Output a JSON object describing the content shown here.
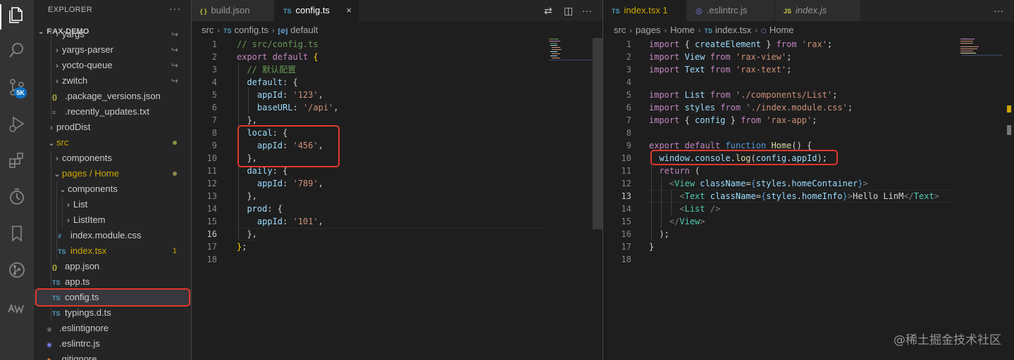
{
  "explorer": {
    "title": "EXPLORER",
    "more": "···",
    "project": "RAX-DEMO",
    "items": [
      {
        "label": "yargs",
        "icon": "folder",
        "depth": 1,
        "status": ""
      },
      {
        "label": "yargs-parser",
        "icon": "folder",
        "depth": 1,
        "status": ""
      },
      {
        "label": "yocto-queue",
        "icon": "folder",
        "depth": 1,
        "status": ""
      },
      {
        "label": "zwitch",
        "icon": "folder",
        "depth": 1,
        "status": ""
      },
      {
        "label": ".package_versions.json",
        "icon": "json",
        "depth": 1,
        "status": ""
      },
      {
        "label": ".recently_updates.txt",
        "icon": "txt",
        "depth": 1,
        "status": ""
      },
      {
        "label": "prodDist",
        "icon": "folder",
        "depth": 0,
        "status": ""
      },
      {
        "label": "src",
        "icon": "folder-open",
        "depth": 0,
        "status": "dot"
      },
      {
        "label": "components",
        "icon": "folder",
        "depth": 1,
        "status": ""
      },
      {
        "label": "pages / Home",
        "icon": "folder-open",
        "depth": 1,
        "status": "dot"
      },
      {
        "label": "components",
        "icon": "folder-open",
        "depth": 2,
        "status": ""
      },
      {
        "label": "List",
        "icon": "folder",
        "depth": 3,
        "status": ""
      },
      {
        "label": "ListItem",
        "icon": "folder",
        "depth": 3,
        "status": ""
      },
      {
        "label": "index.module.css",
        "icon": "css",
        "depth": 2,
        "status": ""
      },
      {
        "label": "index.tsx",
        "icon": "ts",
        "depth": 2,
        "status": "1"
      },
      {
        "label": "app.json",
        "icon": "json",
        "depth": 1,
        "status": ""
      },
      {
        "label": "app.ts",
        "icon": "ts",
        "depth": 1,
        "status": ""
      },
      {
        "label": "config.ts",
        "icon": "ts",
        "depth": 1,
        "status": ""
      },
      {
        "label": "typings.d.ts",
        "icon": "ts",
        "depth": 1,
        "status": ""
      },
      {
        "label": ".eslintignore",
        "icon": "eslintignore",
        "depth": 0,
        "status": ""
      },
      {
        "label": ".eslintrc.js",
        "icon": "eslint",
        "depth": 0,
        "status": ""
      },
      {
        "label": ".gitignore",
        "icon": "git",
        "depth": 0,
        "status": ""
      }
    ]
  },
  "activity_bar": {
    "scm_badge": "5K",
    "icons": [
      "files-icon",
      "search-icon",
      "source-control-icon",
      "run-debug-icon",
      "extensions-icon",
      "timeline-icon",
      "bookmark-icon",
      "git-graph-icon",
      "aw-icon"
    ]
  },
  "left_editor": {
    "tabs": [
      {
        "icon": "{ }",
        "label": "build.json",
        "active": false
      },
      {
        "icon": "TS",
        "label": "config.ts",
        "active": true,
        "close": "×"
      }
    ],
    "breadcrumbs": [
      "src",
      "config.ts",
      "default"
    ],
    "breadcrumb_icons": [
      "TS",
      "[⊘]"
    ],
    "lines": [
      [
        [
          "cm",
          "// src/config.ts"
        ]
      ],
      [
        [
          "kw",
          "export"
        ],
        [
          "pl",
          " "
        ],
        [
          "kw",
          "default"
        ],
        [
          "pl",
          " "
        ],
        [
          "br",
          "{"
        ]
      ],
      [
        [
          "pl",
          "  "
        ],
        [
          "cm",
          "// 默认配置"
        ]
      ],
      [
        [
          "pl",
          "  "
        ],
        [
          "pr",
          "default"
        ],
        [
          "pl",
          ": {"
        ]
      ],
      [
        [
          "pl",
          "    "
        ],
        [
          "pr",
          "appId"
        ],
        [
          "pl",
          ": "
        ],
        [
          "st",
          "'123'"
        ],
        [
          "pl",
          ","
        ]
      ],
      [
        [
          "pl",
          "    "
        ],
        [
          "pr",
          "baseURL"
        ],
        [
          "pl",
          ": "
        ],
        [
          "st",
          "'/api'"
        ],
        [
          "pl",
          ","
        ]
      ],
      [
        [
          "pl",
          "  },"
        ]
      ],
      [
        [
          "pl",
          "  "
        ],
        [
          "pr",
          "local"
        ],
        [
          "pl",
          ": {"
        ]
      ],
      [
        [
          "pl",
          "    "
        ],
        [
          "pr",
          "appId"
        ],
        [
          "pl",
          ": "
        ],
        [
          "st",
          "'456'"
        ],
        [
          "pl",
          ","
        ]
      ],
      [
        [
          "pl",
          "  },"
        ]
      ],
      [
        [
          "pl",
          "  "
        ],
        [
          "pr",
          "daily"
        ],
        [
          "pl",
          ": {"
        ]
      ],
      [
        [
          "pl",
          "    "
        ],
        [
          "pr",
          "appId"
        ],
        [
          "pl",
          ": "
        ],
        [
          "st",
          "'789'"
        ],
        [
          "pl",
          ","
        ]
      ],
      [
        [
          "pl",
          "  },"
        ]
      ],
      [
        [
          "pl",
          "  "
        ],
        [
          "pr",
          "prod"
        ],
        [
          "pl",
          ": {"
        ]
      ],
      [
        [
          "pl",
          "    "
        ],
        [
          "pr",
          "appId"
        ],
        [
          "pl",
          ": "
        ],
        [
          "st",
          "'101'"
        ],
        [
          "pl",
          ","
        ]
      ],
      [
        [
          "pl",
          "  },"
        ]
      ],
      [
        [
          "br",
          "}"
        ],
        [
          "pl",
          ";"
        ]
      ],
      []
    ],
    "current_line": 16
  },
  "right_editor": {
    "tabs": [
      {
        "icon": "TS",
        "label": "index.tsx 1",
        "active": true
      },
      {
        "icon": "◎",
        "label": ".eslintrc.js",
        "active": false
      },
      {
        "icon": "JS",
        "label": "index.js",
        "active": false
      }
    ],
    "breadcrumbs": [
      "src",
      "pages",
      "Home",
      "index.tsx",
      "Home"
    ],
    "lines": [
      [
        [
          "kw",
          "import"
        ],
        [
          "pl",
          " { "
        ],
        [
          "va",
          "createElement"
        ],
        [
          "pl",
          " } "
        ],
        [
          "kw",
          "from"
        ],
        [
          "pl",
          " "
        ],
        [
          "st",
          "'rax'"
        ],
        [
          "pl",
          ";"
        ]
      ],
      [
        [
          "kw",
          "import"
        ],
        [
          "pl",
          " "
        ],
        [
          "va",
          "View"
        ],
        [
          "pl",
          " "
        ],
        [
          "kw",
          "from"
        ],
        [
          "pl",
          " "
        ],
        [
          "st",
          "'rax-view'"
        ],
        [
          "pl",
          ";"
        ]
      ],
      [
        [
          "kw",
          "import"
        ],
        [
          "pl",
          " "
        ],
        [
          "va",
          "Text"
        ],
        [
          "pl",
          " "
        ],
        [
          "kw",
          "from"
        ],
        [
          "pl",
          " "
        ],
        [
          "st",
          "'rax-text'"
        ],
        [
          "pl",
          ";"
        ]
      ],
      [],
      [
        [
          "kw",
          "import"
        ],
        [
          "pl",
          " "
        ],
        [
          "va",
          "List"
        ],
        [
          "pl",
          " "
        ],
        [
          "kw",
          "from"
        ],
        [
          "pl",
          " "
        ],
        [
          "st",
          "'./components/List'"
        ],
        [
          "pl",
          ";"
        ]
      ],
      [
        [
          "kw",
          "import"
        ],
        [
          "pl",
          " "
        ],
        [
          "va",
          "styles"
        ],
        [
          "pl",
          " "
        ],
        [
          "kw",
          "from"
        ],
        [
          "pl",
          " "
        ],
        [
          "st",
          "'./index.module.css'"
        ],
        [
          "pl",
          ";"
        ]
      ],
      [
        [
          "kw",
          "import"
        ],
        [
          "pl",
          " { "
        ],
        [
          "va",
          "config"
        ],
        [
          "pl",
          " } "
        ],
        [
          "kw",
          "from"
        ],
        [
          "pl",
          " "
        ],
        [
          "st",
          "'rax-app'"
        ],
        [
          "pl",
          ";"
        ]
      ],
      [],
      [
        [
          "kw",
          "export"
        ],
        [
          "pl",
          " "
        ],
        [
          "kw",
          "default"
        ],
        [
          "pl",
          " "
        ],
        [
          "kb",
          "function"
        ],
        [
          "pl",
          " "
        ],
        [
          "fn",
          "Home"
        ],
        [
          "pl",
          "() {"
        ]
      ],
      [
        [
          "pl",
          "  "
        ],
        [
          "va",
          "window"
        ],
        [
          "pl",
          "."
        ],
        [
          "va",
          "console"
        ],
        [
          "pl",
          "."
        ],
        [
          "fn",
          "log"
        ],
        [
          "pl",
          "("
        ],
        [
          "va",
          "config"
        ],
        [
          "pl",
          "."
        ],
        [
          "va",
          "appId"
        ],
        [
          "pl",
          ");"
        ]
      ],
      [
        [
          "pl",
          "  "
        ],
        [
          "kw",
          "return"
        ],
        [
          "pl",
          " ("
        ]
      ],
      [
        [
          "pl",
          "    "
        ],
        [
          "tp",
          "<"
        ],
        [
          "tg",
          "View"
        ],
        [
          "pl",
          " "
        ],
        [
          "va",
          "className"
        ],
        [
          "pl",
          "="
        ],
        [
          "kb",
          "{"
        ],
        [
          "va",
          "styles"
        ],
        [
          "pl",
          "."
        ],
        [
          "va",
          "homeContainer"
        ],
        [
          "kb",
          "}"
        ],
        [
          "tp",
          ">"
        ]
      ],
      [
        [
          "pl",
          "      "
        ],
        [
          "tp",
          "<"
        ],
        [
          "tg",
          "Text"
        ],
        [
          "pl",
          " "
        ],
        [
          "va",
          "className"
        ],
        [
          "pl",
          "="
        ],
        [
          "kb",
          "{"
        ],
        [
          "va",
          "styles"
        ],
        [
          "pl",
          "."
        ],
        [
          "va",
          "homeInfo"
        ],
        [
          "kb",
          "}"
        ],
        [
          "tp",
          ">"
        ],
        [
          "pl",
          "Hello LinM"
        ],
        [
          "tp",
          "</"
        ],
        [
          "tg",
          "Text"
        ],
        [
          "tp",
          ">"
        ]
      ],
      [
        [
          "pl",
          "      "
        ],
        [
          "tp",
          "<"
        ],
        [
          "tg",
          "List"
        ],
        [
          "pl",
          " "
        ],
        [
          "tp",
          "/>"
        ]
      ],
      [
        [
          "pl",
          "    "
        ],
        [
          "tp",
          "</"
        ],
        [
          "tg",
          "View"
        ],
        [
          "tp",
          ">"
        ]
      ],
      [
        [
          "pl",
          "  );"
        ]
      ],
      [
        [
          "pl",
          "}"
        ]
      ],
      []
    ],
    "current_line": 13
  },
  "watermark": "@稀土掘金技术社区"
}
